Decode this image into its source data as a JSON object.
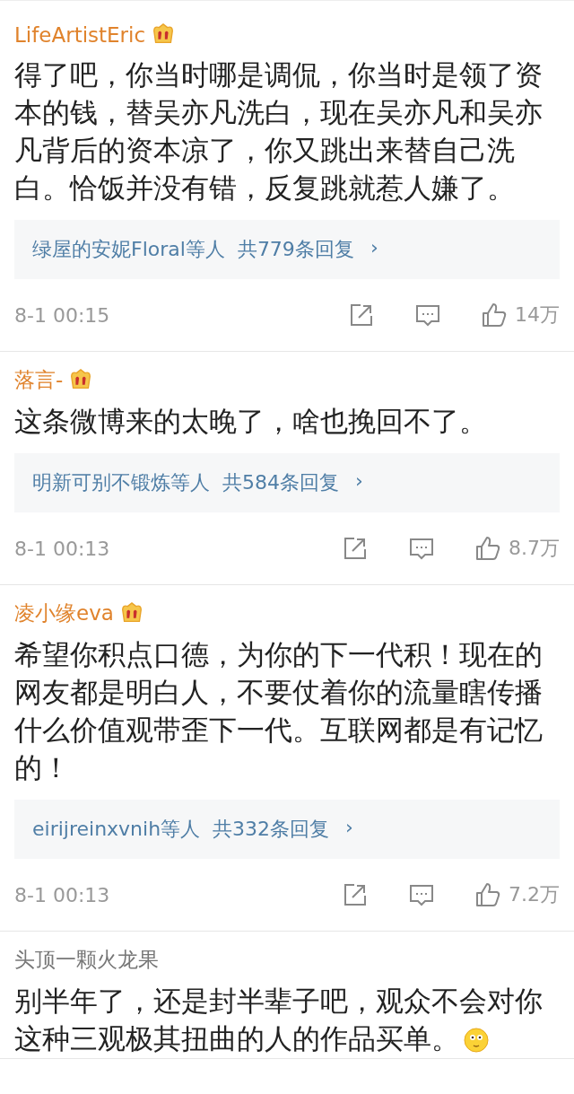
{
  "comments": [
    {
      "user": "LifeArtistEric",
      "vip": true,
      "text": "得了吧，你当时哪是调侃，你当时是领了资本的钱，替吴亦凡洗白，现在吴亦凡和吴亦凡背后的资本凉了，你又跳出来替自己洗白。恰饭并没有错，反复跳就惹人嫌了。",
      "replies": {
        "names": "绿屋的安妮Floral等人",
        "count": "共779条回复",
        "chevron": "›"
      },
      "time": "8-1 00:15",
      "likes": "14万"
    },
    {
      "user": "落言-",
      "vip": true,
      "text": "这条微博来的太晚了，啥也挽回不了。",
      "replies": {
        "names": "明新可别不锻炼等人",
        "count": "共584条回复",
        "chevron": "›"
      },
      "time": "8-1 00:13",
      "likes": "8.7万"
    },
    {
      "user": "凌小缘eva",
      "vip": true,
      "text": "希望你积点口德，为你的下一代积！现在的网友都是明白人，不要仗着你的流量瞎传播什么价值观带歪下一代。互联网都是有记忆的！",
      "replies": {
        "names": "eirijreinxvnih等人",
        "count": "共332条回复",
        "chevron": "›"
      },
      "time": "8-1 00:13",
      "likes": "7.2万"
    },
    {
      "user": "头顶一颗火龙果",
      "vip": false,
      "text": "别半年了，还是封半辈子吧，观众不会对你这种三观极其扭曲的人的作品买单。",
      "emoji": true
    }
  ]
}
